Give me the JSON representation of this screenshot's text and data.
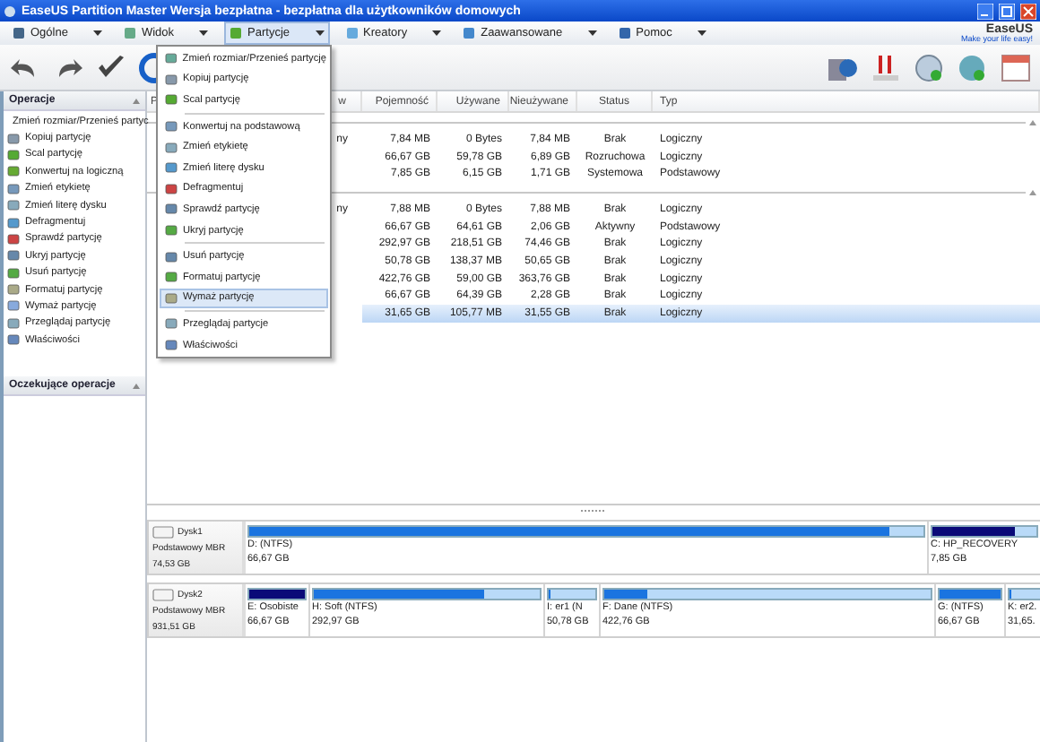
{
  "window": {
    "title": "EaseUS Partition Master Wersja bezpłatna - bezpłatna dla użytkowników domowych"
  },
  "menu_bar": [
    {
      "label": "Ogólne",
      "selected": false
    },
    {
      "label": "Widok",
      "selected": false
    },
    {
      "label": "Partycje",
      "selected": true
    },
    {
      "label": "Kreatory",
      "selected": false
    },
    {
      "label": "Zaawansowane",
      "selected": false
    },
    {
      "label": "Pomoc",
      "selected": false
    }
  ],
  "logo": {
    "name": "EaseUS",
    "tagline": "Make your life easy!"
  },
  "operations_panel": {
    "title": "Operacje",
    "items": [
      "Zmień rozmiar/Przenieś partyc",
      "Kopiuj partycję",
      "Scal partycję",
      "Konwertuj na logiczną",
      "Zmień etykietę",
      "Zmień literę dysku",
      "Defragmentuj",
      "Sprawdź partycję",
      "Ukryj partycję",
      "Usuń partycję",
      "Formatuj partycję",
      "Wymaż partycję",
      "Przeglądaj partycję",
      "Właściwości"
    ]
  },
  "pending_panel": {
    "title": "Oczekujące operacje"
  },
  "partition_menu": {
    "groups": [
      [
        {
          "label": "Zmień rozmiar/Przenieś partycję",
          "selected": false
        },
        {
          "label": "Kopiuj partycję",
          "selected": false
        },
        {
          "label": "Scal partycję",
          "selected": false
        }
      ],
      [
        {
          "label": "Konwertuj na podstawową",
          "selected": false
        },
        {
          "label": "Zmień etykietę",
          "selected": false
        },
        {
          "label": "Zmień literę dysku",
          "selected": false
        },
        {
          "label": "Defragmentuj",
          "selected": false
        },
        {
          "label": "Sprawdź partycję",
          "selected": false
        },
        {
          "label": "Ukryj partycję",
          "selected": false
        }
      ],
      [
        {
          "label": "Usuń partycję",
          "selected": false
        },
        {
          "label": "Formatuj partycję",
          "selected": false
        },
        {
          "label": "Wymaż partycję",
          "selected": true
        }
      ],
      [
        {
          "label": "Przeglądaj partycje",
          "selected": false
        },
        {
          "label": "Właściwości",
          "selected": false
        }
      ]
    ]
  },
  "table": {
    "columns": [
      "P",
      "w",
      "Pojemność",
      "Używane",
      "Nieużywane",
      "Status",
      "Typ"
    ],
    "groups": [
      {
        "rows": [
          {
            "cells": [
              "",
              "ny",
              "7,84 MB",
              "0 Bytes",
              "7,84 MB",
              "Brak",
              "Logiczny"
            ],
            "selected": false
          },
          {
            "cells": [
              "",
              "",
              "66,67 GB",
              "59,78 GB",
              "6,89 GB",
              "Rozruchowa",
              "Logiczny"
            ],
            "selected": false
          },
          {
            "cells": [
              "",
              "",
              "7,85 GB",
              "6,15 GB",
              "1,71 GB",
              "Systemowa",
              "Podstawowy"
            ],
            "selected": false
          }
        ]
      },
      {
        "rows": [
          {
            "cells": [
              "",
              "ny",
              "7,88 MB",
              "0 Bytes",
              "7,88 MB",
              "Brak",
              "Logiczny"
            ],
            "selected": false
          },
          {
            "cells": [
              "",
              "",
              "66,67 GB",
              "64,61 GB",
              "2,06 GB",
              "Aktywny",
              "Podstawowy"
            ],
            "selected": false
          },
          {
            "cells": [
              "",
              "",
              "292,97 GB",
              "218,51 GB",
              "74,46 GB",
              "Brak",
              "Logiczny"
            ],
            "selected": false
          },
          {
            "cells": [
              "",
              "",
              "50,78 GB",
              "138,37 MB",
              "50,65 GB",
              "Brak",
              "Logiczny"
            ],
            "selected": false
          },
          {
            "cells": [
              "",
              "",
              "422,76 GB",
              "59,00 GB",
              "363,76 GB",
              "Brak",
              "Logiczny"
            ],
            "selected": false
          },
          {
            "cells": [
              "",
              "",
              "66,67 GB",
              "64,39 GB",
              "2,28 GB",
              "Brak",
              "Logiczny"
            ],
            "selected": false
          },
          {
            "cells": [
              "",
              "",
              "31,65 GB",
              "105,77 MB",
              "31,55 GB",
              "Brak",
              "Logiczny"
            ],
            "selected": true
          }
        ]
      }
    ]
  },
  "disks": [
    {
      "name": "Dysk1",
      "type": "Podstawowy MBR",
      "size": "74,53 GB",
      "partitions": [
        {
          "label": "D: (NTFS)",
          "size": "66,67 GB",
          "level": 0.95,
          "color": "#1a74e0"
        },
        {
          "label": "C: HP_RECOVERY",
          "size": "7,85 GB",
          "level": 0.8,
          "color": "#0a0a78"
        }
      ]
    },
    {
      "name": "Dysk2",
      "type": "Podstawowy MBR",
      "size": "931,51 GB",
      "partitions": [
        {
          "label": "E: Osobiste",
          "size": "66,67 GB",
          "level": 1,
          "color": "#0a0a78"
        },
        {
          "label": "H: Soft (NTFS)",
          "size": "292,97 GB",
          "level": 0.75,
          "color": "#1a74e0"
        },
        {
          "label": "I: er1 (N",
          "size": "50,78 GB",
          "level": 0.02,
          "color": "#1a74e0"
        },
        {
          "label": "F: Dane (NTFS)",
          "size": "422,76 GB",
          "level": 0.13,
          "color": "#1a74e0"
        },
        {
          "label": "G: (NTFS)",
          "size": "66,67 GB",
          "level": 1,
          "color": "#1a74e0"
        },
        {
          "label": "K: er2.",
          "size": "31,65.",
          "level": 0.02,
          "color": "#1a74e0"
        }
      ]
    }
  ]
}
